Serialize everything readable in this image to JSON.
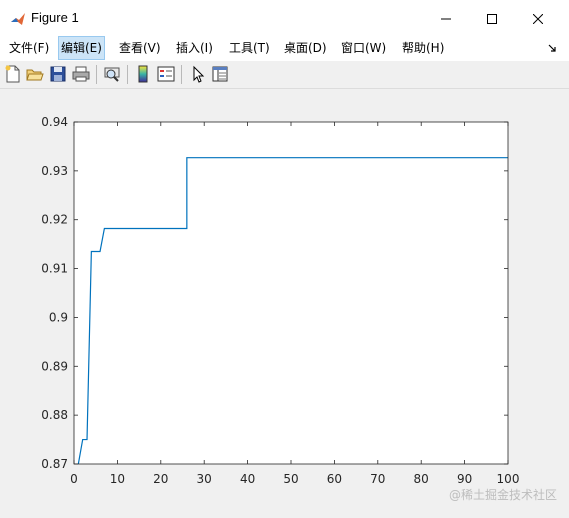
{
  "window": {
    "title": "Figure 1"
  },
  "menu": [
    {
      "label": "文件(F)"
    },
    {
      "label": "编辑(E)"
    },
    {
      "label": "查看(V)"
    },
    {
      "label": "插入(I)"
    },
    {
      "label": "工具(T)"
    },
    {
      "label": "桌面(D)"
    },
    {
      "label": "窗口(W)"
    },
    {
      "label": "帮助(H)"
    }
  ],
  "toolbar": {
    "icons": [
      "new-figure-icon",
      "open-file-icon",
      "save-icon",
      "print-icon",
      "print-preview-icon",
      "colorbar-icon",
      "legend-icon",
      "pointer-icon",
      "property-inspector-icon"
    ]
  },
  "chart_data": {
    "type": "line",
    "title": "",
    "xlabel": "",
    "ylabel": "",
    "xlim": [
      0,
      100
    ],
    "ylim": [
      0.87,
      0.94
    ],
    "xticks": [
      "0",
      "10",
      "20",
      "30",
      "40",
      "50",
      "60",
      "70",
      "80",
      "90",
      "100"
    ],
    "yticks": [
      "0.87",
      "0.88",
      "0.89",
      "0.9",
      "0.91",
      "0.92",
      "0.93",
      "0.94"
    ],
    "grid": false,
    "color": "#0072bd",
    "series": [
      {
        "x": [
          1,
          2,
          2,
          3,
          3,
          4,
          4,
          6,
          6,
          7,
          7,
          26,
          26,
          100
        ],
        "y": [
          0.87,
          0.875,
          0.875,
          0.875,
          0.875,
          0.9135,
          0.9135,
          0.9135,
          0.9135,
          0.9182,
          0.9182,
          0.9182,
          0.9327,
          0.9327
        ]
      }
    ]
  },
  "watermark": "@稀土掘金技术社区"
}
